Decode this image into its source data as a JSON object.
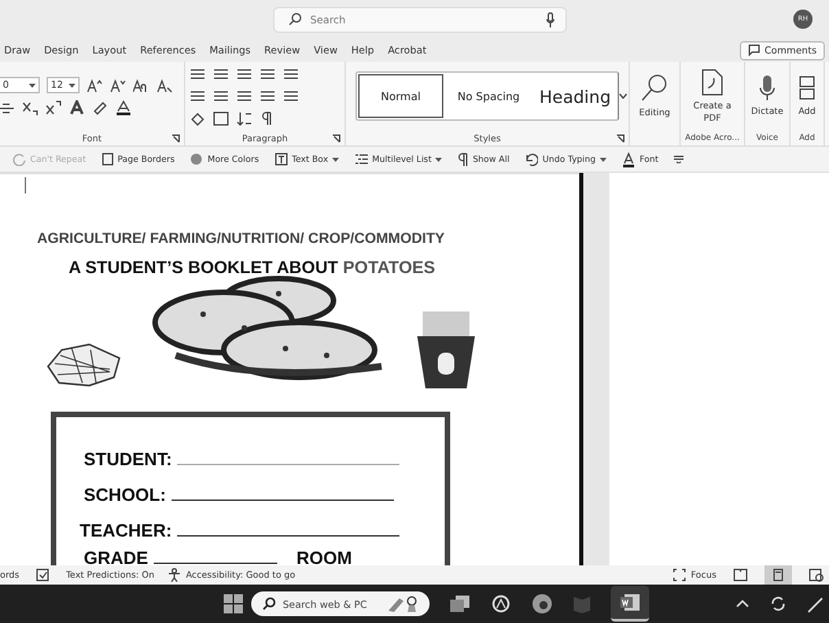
{
  "title_bar": {
    "search_placeholder": "Search",
    "avatar": "RH"
  },
  "tabs": [
    {
      "label": "Draw",
      "selected": false
    },
    {
      "label": "Design",
      "selected": false
    },
    {
      "label": "Layout",
      "selected": false
    },
    {
      "label": "References",
      "selected": false
    },
    {
      "label": "Mailings",
      "selected": false
    },
    {
      "label": "Review",
      "selected": false
    },
    {
      "label": "View",
      "selected": false
    },
    {
      "label": "Help",
      "selected": false
    },
    {
      "label": "Acrobat",
      "selected": false
    }
  ],
  "comments_button": "Comments",
  "ribbon": {
    "font": {
      "name_value": "0",
      "size_value": "12",
      "label": "Font"
    },
    "paragraph": {
      "label": "Paragraph"
    },
    "styles": {
      "items": [
        {
          "label": "Normal",
          "selected": true,
          "kind": "normal"
        },
        {
          "label": "No Spacing",
          "selected": false,
          "kind": "nospacing"
        },
        {
          "label": "Heading",
          "selected": false,
          "kind": "heading"
        }
      ],
      "label": "Styles"
    },
    "groups": [
      {
        "kind": "editing",
        "button": "Editing"
      },
      {
        "kind": "pdf",
        "button": "Create a PDF",
        "label": "Adobe Acro..."
      },
      {
        "kind": "dictate",
        "button": "Dictate",
        "label": "Voice"
      },
      {
        "kind": "add",
        "button": "Add",
        "label": "Add"
      }
    ]
  },
  "quick_toolbar": [
    {
      "kind": "repeat",
      "label": "Can't Repeat",
      "disabled": true
    },
    {
      "kind": "borders",
      "label": "Page Borders",
      "disabled": false
    },
    {
      "kind": "colors",
      "label": "More Colors",
      "disabled": false
    },
    {
      "kind": "textbox",
      "label": "Text Box",
      "disabled": false
    },
    {
      "kind": "multilevel",
      "label": "Multilevel List",
      "disabled": false
    },
    {
      "kind": "showall",
      "label": "Show All",
      "disabled": false
    },
    {
      "kind": "undo",
      "label": "Undo Typing",
      "disabled": false
    },
    {
      "kind": "font",
      "label": "Font",
      "disabled": false
    }
  ],
  "document": {
    "subject": "AGRICULTURE/ FARMING/NUTRITION/ CROP/COMMODITY",
    "title": [
      {
        "text": "A STUDENT’S BOOKLET ABOUT",
        "muted": false
      },
      {
        "text": "POTATOES",
        "muted": true
      }
    ],
    "form_fields": [
      {
        "label": "STUDENT:"
      },
      {
        "label": "SCHOOL:"
      },
      {
        "label": "TEACHER:"
      }
    ],
    "form_last_row": [
      "GRADE",
      "ROOM"
    ]
  },
  "status_bar": {
    "words": "ords",
    "text_predictions": "Text Predictions: On",
    "accessibility": "Accessibility: Good to go",
    "focus": "Focus"
  },
  "taskbar": {
    "search_placeholder": "Search web & PC"
  }
}
